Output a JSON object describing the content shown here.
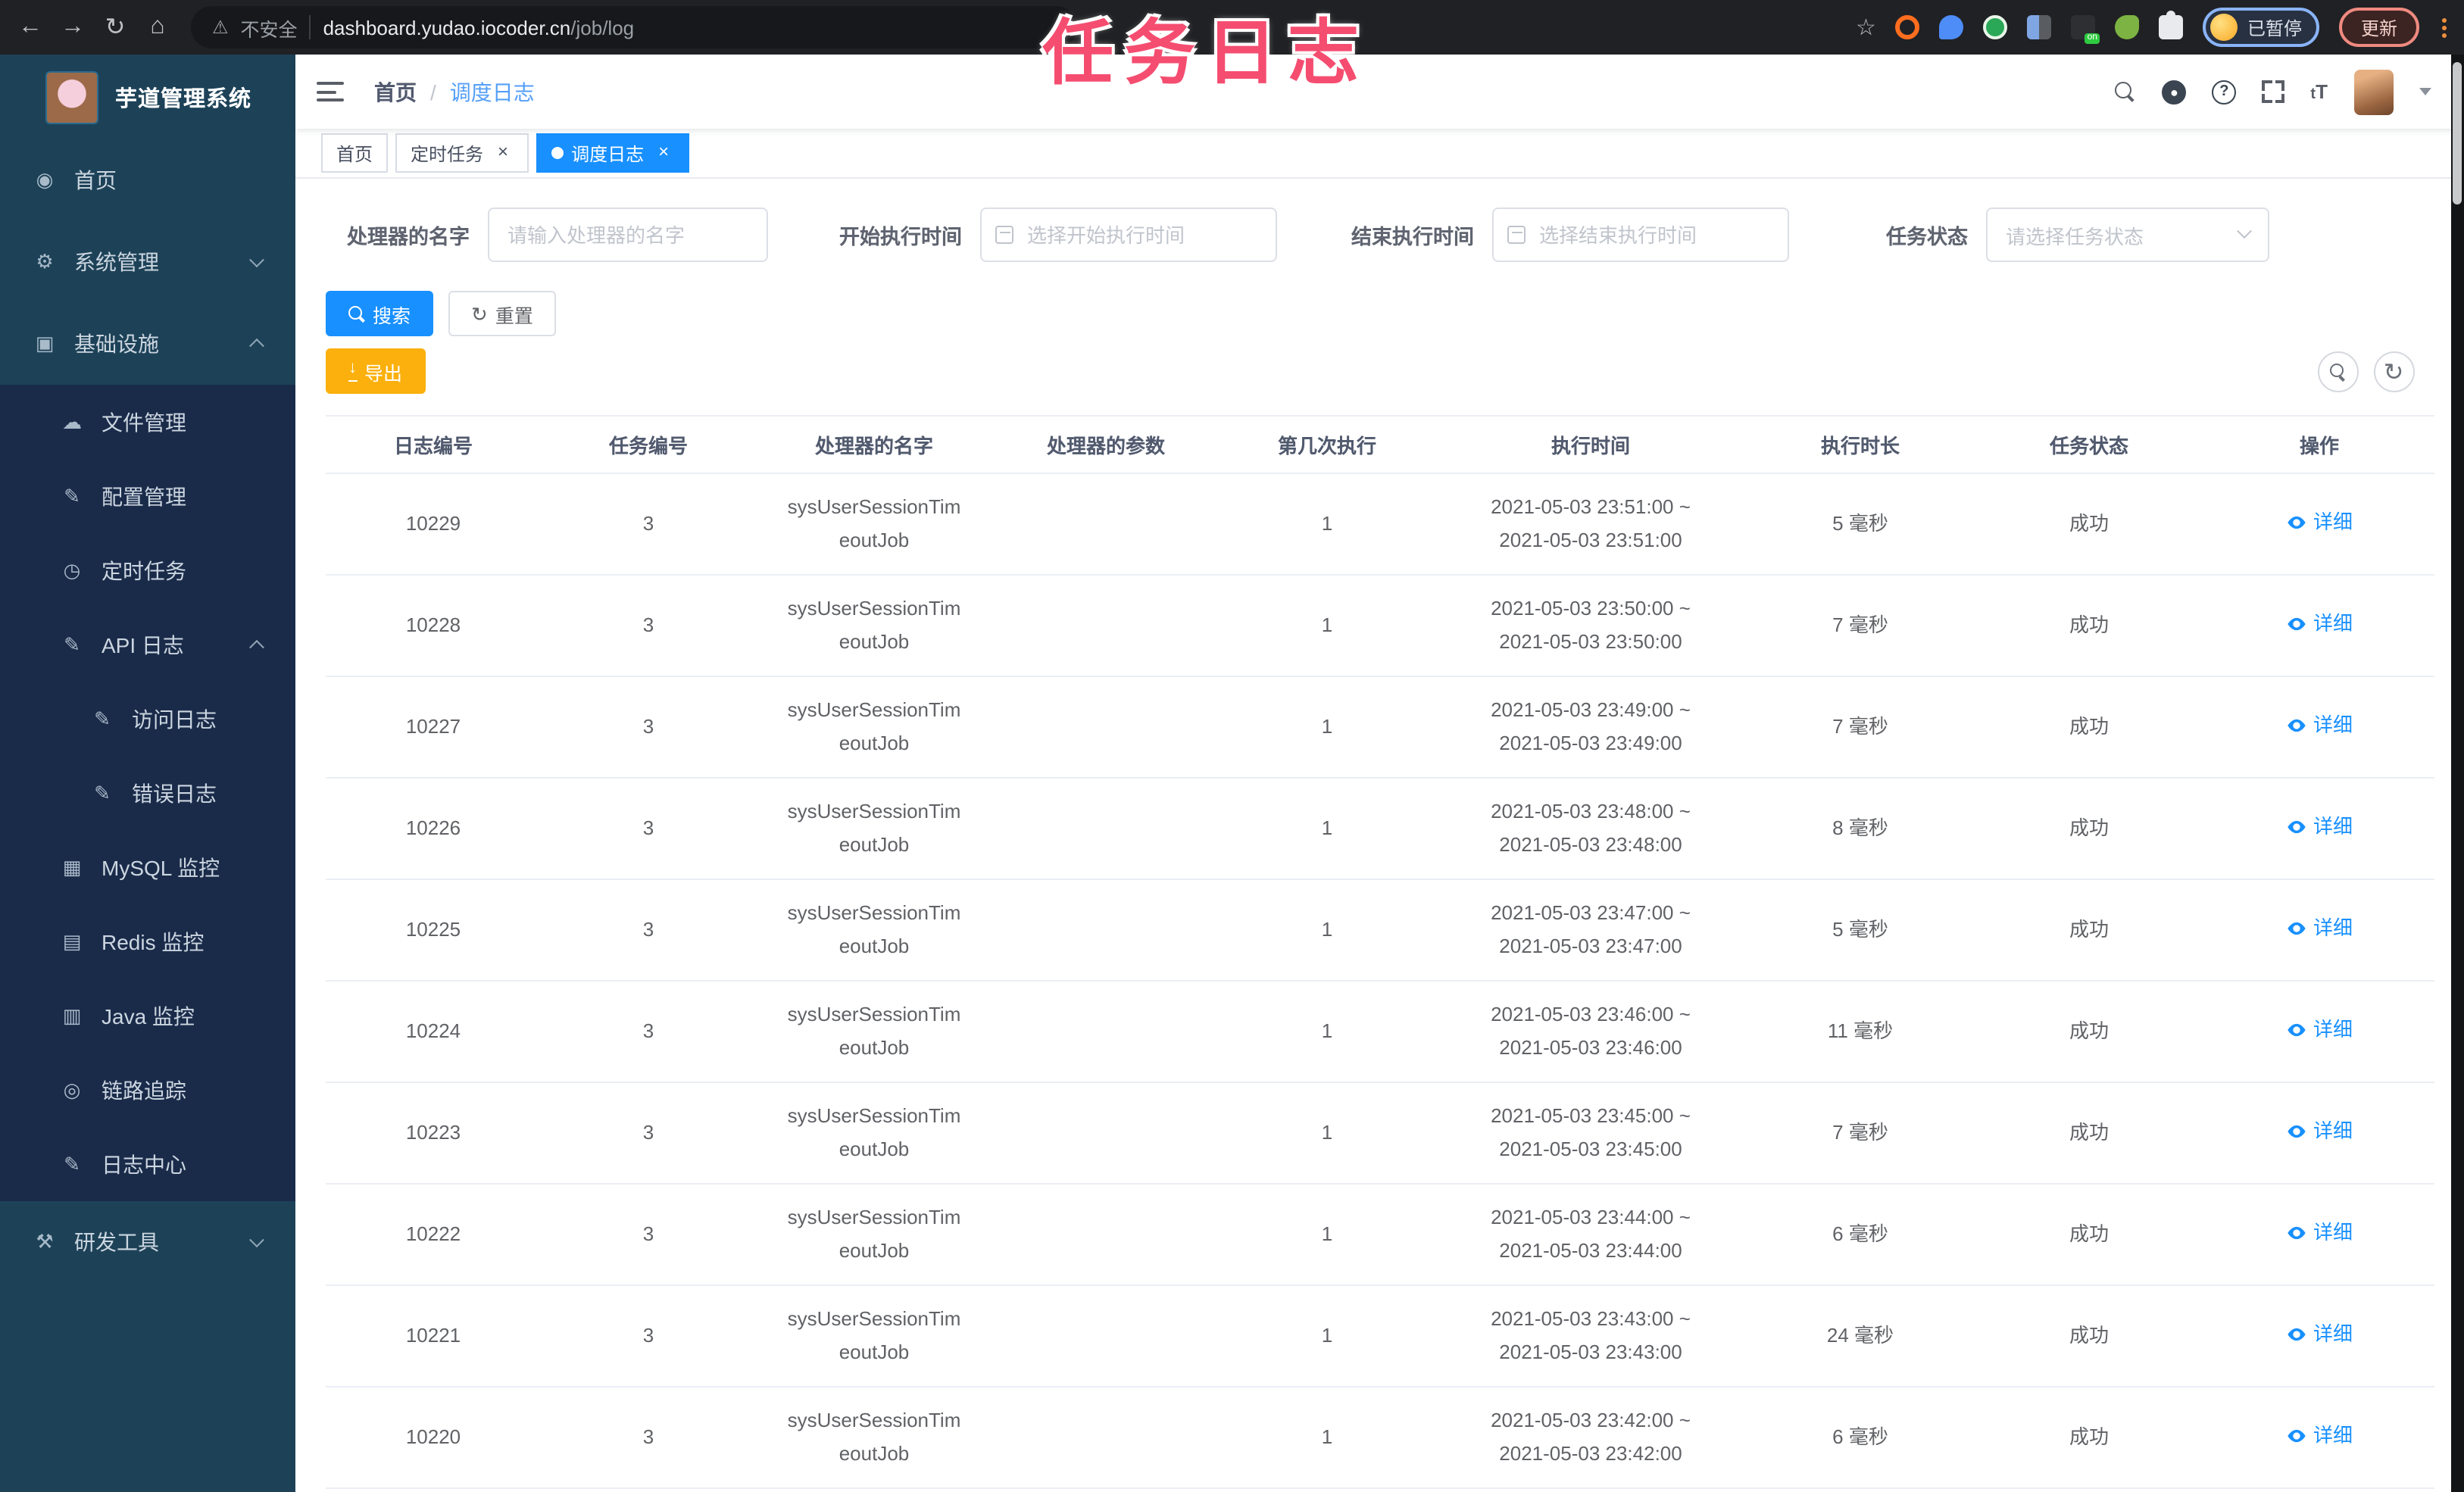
{
  "browser": {
    "security_label": "不安全",
    "url_host": "dashboard.yudao.iocoder.cn",
    "url_path": "/job/log",
    "profile_status": "已暂停",
    "update_label": "更新"
  },
  "overlay": {
    "title": "任务日志",
    "color": "#f54d70"
  },
  "sidebar": {
    "logo_title": "芋道管理系统",
    "items": [
      {
        "icon": "dashboard-icon",
        "label": "首页",
        "level": 1
      },
      {
        "icon": "gear-icon",
        "label": "系统管理",
        "level": 1,
        "arrow": "down"
      },
      {
        "icon": "monitor-icon",
        "label": "基础设施",
        "level": 1,
        "arrow": "up"
      },
      {
        "icon": "cloud-upload-icon",
        "label": "文件管理",
        "level": 2
      },
      {
        "icon": "edit-square-icon",
        "label": "配置管理",
        "level": 2
      },
      {
        "icon": "timer-icon",
        "label": "定时任务",
        "level": 2
      },
      {
        "icon": "edit-square-icon",
        "label": "API 日志",
        "level": 2,
        "arrow": "up"
      },
      {
        "icon": "edit-square-icon",
        "label": "访问日志",
        "level": 3
      },
      {
        "icon": "edit-square-icon",
        "label": "错误日志",
        "level": 3
      },
      {
        "icon": "mysql-icon",
        "label": "MySQL 监控",
        "level": 2
      },
      {
        "icon": "redis-icon",
        "label": "Redis 监控",
        "level": 2
      },
      {
        "icon": "java-icon",
        "label": "Java 监控",
        "level": 2
      },
      {
        "icon": "trace-eye-icon",
        "label": "链路追踪",
        "level": 2
      },
      {
        "icon": "log-center-icon",
        "label": "日志中心",
        "level": 2
      },
      {
        "icon": "toolbox-icon",
        "label": "研发工具",
        "level": 1,
        "arrow": "down"
      }
    ]
  },
  "header": {
    "breadcrumb": [
      "首页",
      "调度日志"
    ],
    "font_size_icon_text": "tT"
  },
  "tabs": [
    {
      "label": "首页",
      "closable": false,
      "active": false
    },
    {
      "label": "定时任务",
      "closable": true,
      "active": false
    },
    {
      "label": "调度日志",
      "closable": true,
      "active": true
    }
  ],
  "filters": {
    "handler_label": "处理器的名字",
    "handler_placeholder": "请输入处理器的名字",
    "start_label": "开始执行时间",
    "start_placeholder": "选择开始执行时间",
    "end_label": "结束执行时间",
    "end_placeholder": "选择结束执行时间",
    "status_label": "任务状态",
    "status_placeholder": "请选择任务状态"
  },
  "actions": {
    "search_label": "搜索",
    "reset_label": "重置",
    "export_label": "导出"
  },
  "table": {
    "headers": [
      "日志编号",
      "任务编号",
      "处理器的名字",
      "处理器的参数",
      "第几次执行",
      "执行时间",
      "执行时长",
      "任务状态",
      "操作"
    ],
    "action_label": "详细",
    "rows": [
      {
        "log_id": "10229",
        "task_id": "3",
        "handler": "sysUserSessionTim\neoutJob",
        "param": "",
        "exec_index": "1",
        "time": "2021-05-03 23:51:00 ~\n2021-05-03 23:51:00",
        "duration": "5 毫秒",
        "status": "成功"
      },
      {
        "log_id": "10228",
        "task_id": "3",
        "handler": "sysUserSessionTim\neoutJob",
        "param": "",
        "exec_index": "1",
        "time": "2021-05-03 23:50:00 ~\n2021-05-03 23:50:00",
        "duration": "7 毫秒",
        "status": "成功"
      },
      {
        "log_id": "10227",
        "task_id": "3",
        "handler": "sysUserSessionTim\neoutJob",
        "param": "",
        "exec_index": "1",
        "time": "2021-05-03 23:49:00 ~\n2021-05-03 23:49:00",
        "duration": "7 毫秒",
        "status": "成功"
      },
      {
        "log_id": "10226",
        "task_id": "3",
        "handler": "sysUserSessionTim\neoutJob",
        "param": "",
        "exec_index": "1",
        "time": "2021-05-03 23:48:00 ~\n2021-05-03 23:48:00",
        "duration": "8 毫秒",
        "status": "成功"
      },
      {
        "log_id": "10225",
        "task_id": "3",
        "handler": "sysUserSessionTim\neoutJob",
        "param": "",
        "exec_index": "1",
        "time": "2021-05-03 23:47:00 ~\n2021-05-03 23:47:00",
        "duration": "5 毫秒",
        "status": "成功"
      },
      {
        "log_id": "10224",
        "task_id": "3",
        "handler": "sysUserSessionTim\neoutJob",
        "param": "",
        "exec_index": "1",
        "time": "2021-05-03 23:46:00 ~\n2021-05-03 23:46:00",
        "duration": "11 毫秒",
        "status": "成功"
      },
      {
        "log_id": "10223",
        "task_id": "3",
        "handler": "sysUserSessionTim\neoutJob",
        "param": "",
        "exec_index": "1",
        "time": "2021-05-03 23:45:00 ~\n2021-05-03 23:45:00",
        "duration": "7 毫秒",
        "status": "成功"
      },
      {
        "log_id": "10222",
        "task_id": "3",
        "handler": "sysUserSessionTim\neoutJob",
        "param": "",
        "exec_index": "1",
        "time": "2021-05-03 23:44:00 ~\n2021-05-03 23:44:00",
        "duration": "6 毫秒",
        "status": "成功"
      },
      {
        "log_id": "10221",
        "task_id": "3",
        "handler": "sysUserSessionTim\neoutJob",
        "param": "",
        "exec_index": "1",
        "time": "2021-05-03 23:43:00 ~\n2021-05-03 23:43:00",
        "duration": "24 毫秒",
        "status": "成功"
      },
      {
        "log_id": "10220",
        "task_id": "3",
        "handler": "sysUserSessionTim\neoutJob",
        "param": "",
        "exec_index": "1",
        "time": "2021-05-03 23:42:00 ~\n2021-05-03 23:42:00",
        "duration": "6 毫秒",
        "status": "成功"
      }
    ]
  },
  "colors": {
    "primary_blue": "#1890ff",
    "warning_yellow": "#fbb00d",
    "sidebar_bg": "#1d4258",
    "submenu_bg": "#1a2b4a",
    "annotation_pink": "#f54d70"
  }
}
